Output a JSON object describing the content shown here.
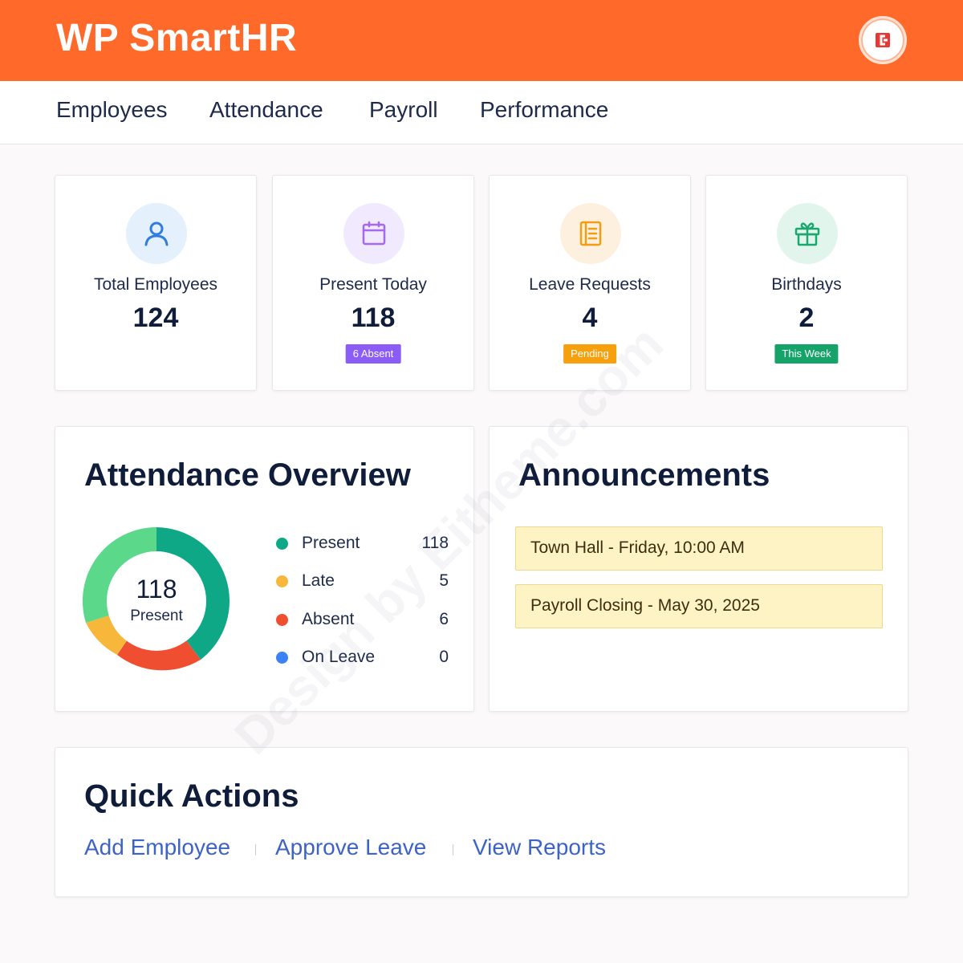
{
  "header": {
    "brand": "WP SmartHR",
    "avatar_icon": "user-avatar-icon"
  },
  "nav": {
    "items": [
      {
        "label": "Employees"
      },
      {
        "label": "Attendance"
      },
      {
        "label": "Payroll"
      },
      {
        "label": "Performance"
      }
    ]
  },
  "stats": [
    {
      "label": "Total Employees",
      "value": "124",
      "icon": "user-icon",
      "icon_color": "#2f7de1",
      "icon_bg": "#e4f0fb"
    },
    {
      "label": "Present Today",
      "value": "118",
      "badge": "6 Absent",
      "badge_color": "#8b5cf6",
      "icon": "calendar-icon",
      "icon_color": "#a569f0",
      "icon_bg": "#f1e9fd"
    },
    {
      "label": "Leave Requests",
      "value": "4",
      "badge": "Pending",
      "badge_color": "#f5a00c",
      "icon": "document-icon",
      "icon_color": "#f29d12",
      "icon_bg": "#fdf0df"
    },
    {
      "label": "Birthdays",
      "value": "2",
      "badge": "This Week",
      "badge_color": "#16a36a",
      "icon": "gift-icon",
      "icon_color": "#1aa86f",
      "icon_bg": "#e2f5ec"
    }
  ],
  "attendance": {
    "title": "Attendance Overview",
    "center_value": "118",
    "center_label": "Present",
    "legend": [
      {
        "label": "Present",
        "value": "118",
        "color": "#0ea887"
      },
      {
        "label": "Late",
        "value": "5",
        "color": "#f7b73b"
      },
      {
        "label": "Absent",
        "value": "6",
        "color": "#f04e30"
      },
      {
        "label": "On Leave",
        "value": "0",
        "color": "#3b82f6"
      }
    ],
    "donut_colors": {
      "present_dark": "#0ea887",
      "present_light": "#5cd88a",
      "late": "#f7b73b",
      "absent": "#f04e30"
    }
  },
  "announcements": {
    "title": "Announcements",
    "items": [
      {
        "text": "Town Hall - Friday, 10:00 AM"
      },
      {
        "text": "Payroll Closing - May 30, 2025"
      }
    ]
  },
  "quick_actions": {
    "title": "Quick Actions",
    "links": [
      {
        "label": "Add Employee"
      },
      {
        "label": "Approve Leave"
      },
      {
        "label": "View Reports"
      }
    ]
  },
  "watermark": "Design by Eitheme.com"
}
